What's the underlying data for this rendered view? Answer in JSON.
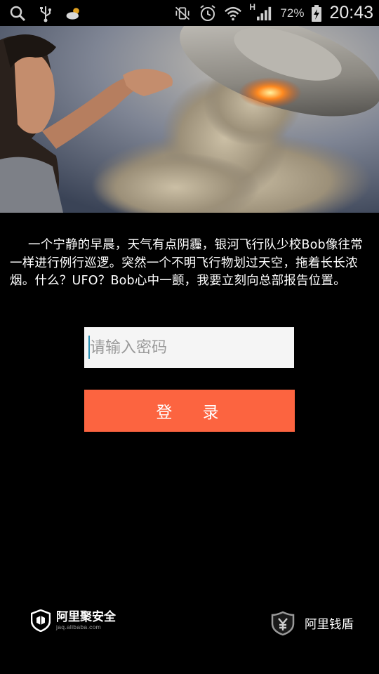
{
  "status_bar": {
    "icons_left": [
      "search-icon",
      "usb-icon",
      "weather-partly-cloudy-icon"
    ],
    "icons_right": [
      "vibrate-mute-icon",
      "alarm-icon",
      "wifi-icon",
      "signal-h-icon",
      "battery-charging-icon"
    ],
    "network_label": "H",
    "battery_percent": "72%",
    "time": "20:43"
  },
  "hero": {
    "image": "ufo-encounter-illustration"
  },
  "story": {
    "text": "一个宁静的早晨，天气有点阴霾，银河飞行队少校Bob像往常一样进行例行巡逻。突然一个不明飞行物划过天空，拖着长长浓烟。什么？UFO？Bob心中一颤，我要立刻向总部报告位置。"
  },
  "password_field": {
    "placeholder": "请输入密码",
    "value": ""
  },
  "login_button": {
    "label": "登 录"
  },
  "footer": {
    "left_brand": "阿里聚安全",
    "left_url": "jaq.alibaba.com",
    "right_brand": "阿里钱盾"
  },
  "colors": {
    "accent": "#fc6440",
    "background": "#000000",
    "cursor": "#2a8fb4"
  }
}
